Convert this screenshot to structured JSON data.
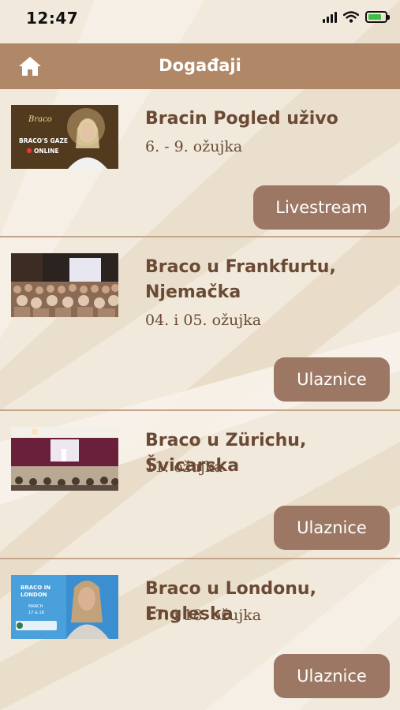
{
  "status_bar": {
    "time": "12:47"
  },
  "nav": {
    "title": "Događaji",
    "home_icon": "home-icon"
  },
  "colors": {
    "nav_bg": "#b08867",
    "button_bg": "#9c7864",
    "title_text": "#6b4a35",
    "divider": "#c4a58a",
    "background": "#f1e9db"
  },
  "events": [
    {
      "title": "Bracin Pogled uživo",
      "date": "6. - 9. ožujka",
      "button": "Livestream",
      "thumb_text": {
        "logo": "Braco",
        "line1": "BRACO'S GAZE",
        "line2": "ONLINE"
      }
    },
    {
      "title": "Braco u Frankfurtu, Njemačka",
      "date": "04. i 05. ožujka",
      "button": "Ulaznice"
    },
    {
      "title": "Braco u Zürichu, Švicarska",
      "date": "11. ožujka",
      "button": "Ulaznice"
    },
    {
      "title": "Braco u Londonu, Engleska",
      "date": "17. i 18. ožujka",
      "button": "Ulaznice",
      "thumb_text": {
        "line1": "BRACO IN",
        "line2": "LONDON",
        "line3": "MARCH",
        "line4": "17 & 18"
      }
    }
  ]
}
